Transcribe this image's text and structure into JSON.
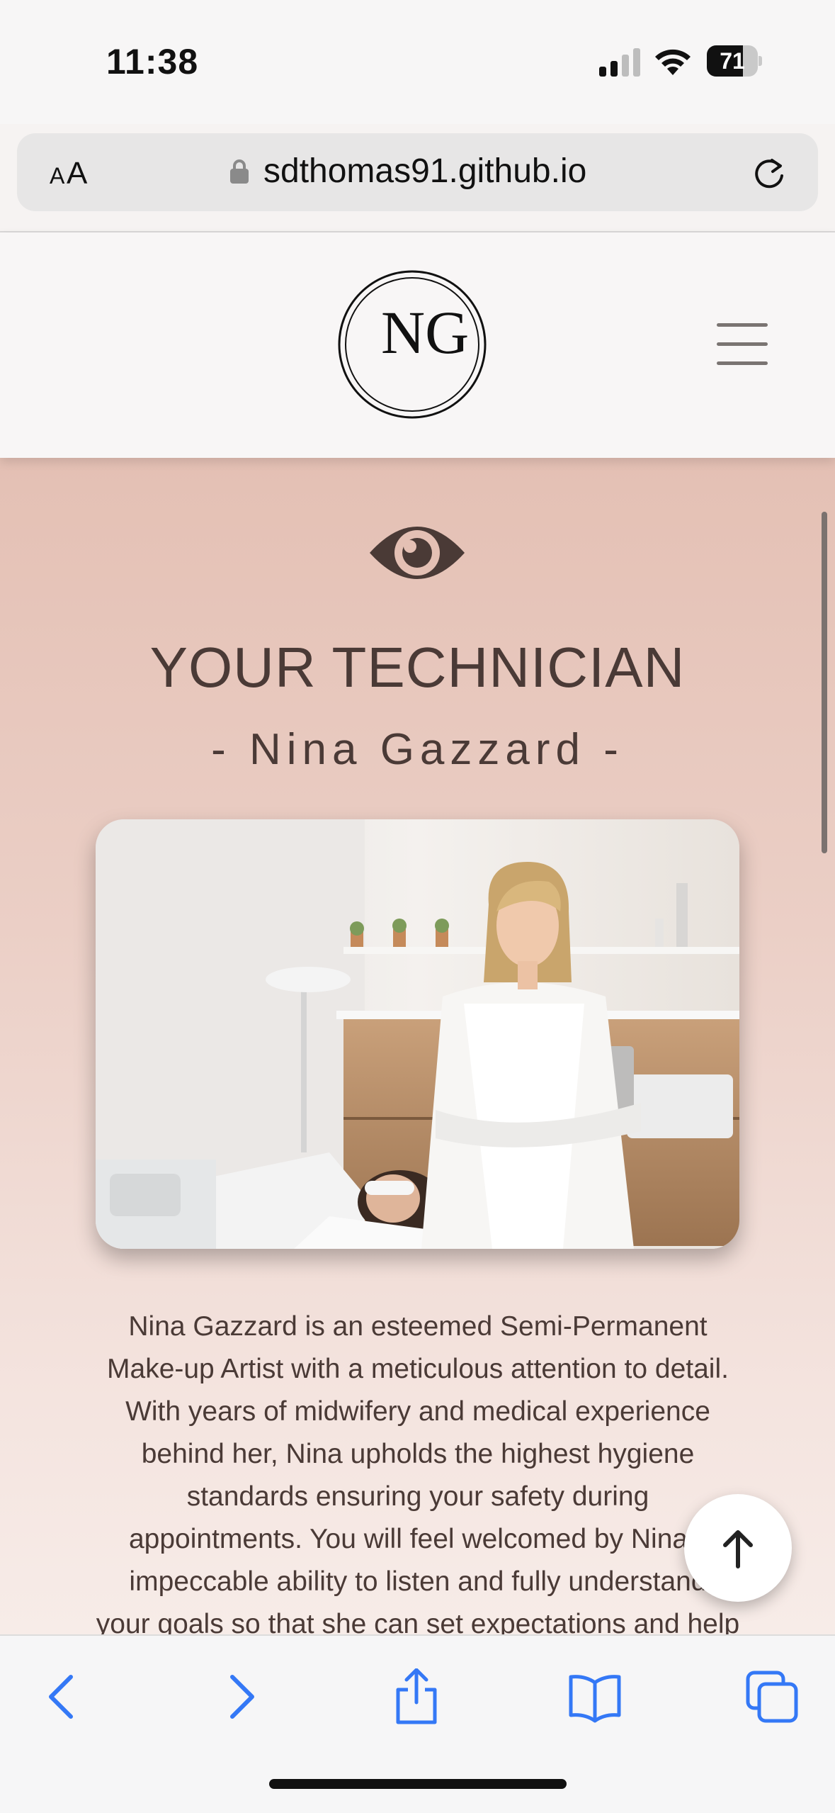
{
  "status": {
    "time": "11:38",
    "battery_level": 71,
    "battery_text": "71"
  },
  "browser": {
    "text_size_small": "A",
    "text_size_large": "A",
    "url": "sdthomas91.github.io"
  },
  "header": {
    "logo_letters": "NG"
  },
  "section": {
    "title": "YOUR TECHNICIAN",
    "subtitle": "- Nina Gazzard -",
    "bio_lines": [
      "Nina Gazzard is an esteemed Semi-Permanent",
      "Make-up Artist with a meticulous attention to detail.",
      "With years of midwifery and medical experience",
      "behind her, Nina upholds the highest hygiene",
      "standards ensuring your safety during",
      "appointments. You will feel welcomed by Nina's",
      "impeccable ability to listen and fully understand",
      "your goals so that she can set expectations and help"
    ]
  },
  "colors": {
    "accent": "#4a3a36",
    "ios_blue": "#3478f6",
    "section_bg_top": "#e4c0b4",
    "section_bg_bottom": "#f7ece8"
  },
  "icons": {
    "lock": "lock-icon",
    "reload": "reload-icon",
    "menu": "hamburger-menu-icon",
    "eye": "eye-icon",
    "back_to_top": "arrow-up-icon",
    "toolbar": [
      "chevron-left-icon",
      "chevron-right-icon",
      "share-icon",
      "bookmarks-icon",
      "tabs-icon"
    ]
  }
}
